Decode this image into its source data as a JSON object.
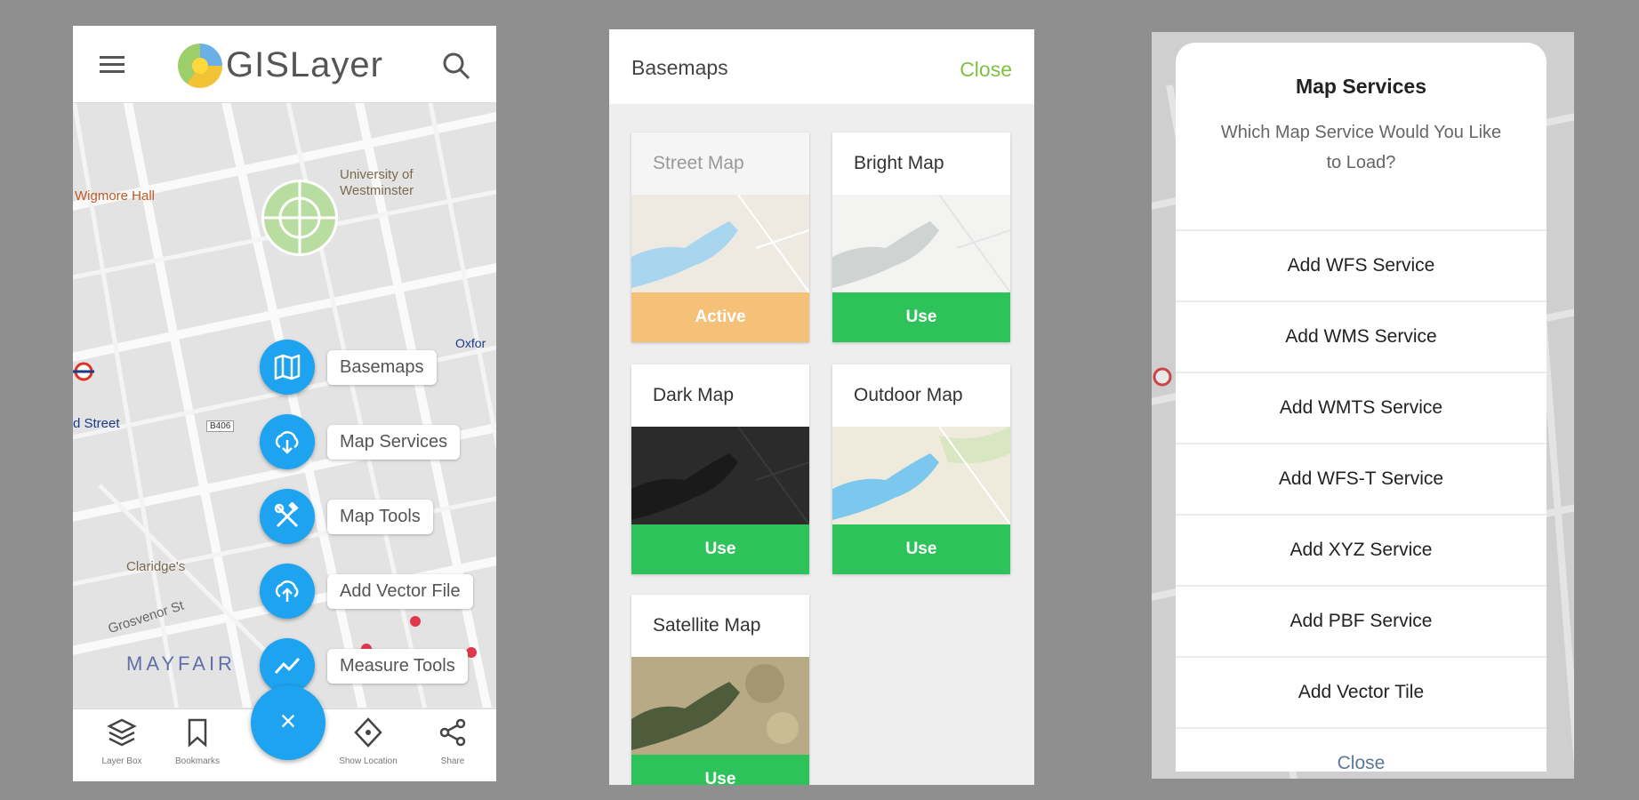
{
  "screen1": {
    "brand": "GISLayer",
    "map_labels": {
      "university": "University of Westminster",
      "wigmore": "Wigmore Hall",
      "street": "d Street",
      "claridges": "Claridge's",
      "grosvenor": "Grosvenor St",
      "mayfair": "MAYFAIR",
      "road_b": "B406",
      "oxford": "Oxfor"
    },
    "menu": [
      {
        "label": "Basemaps",
        "icon": "map-icon"
      },
      {
        "label": "Map Services",
        "icon": "cloud-download-icon"
      },
      {
        "label": "Map Tools",
        "icon": "tools-icon"
      },
      {
        "label": "Add Vector File",
        "icon": "cloud-upload-icon"
      },
      {
        "label": "Measure Tools",
        "icon": "chart-line-icon"
      }
    ],
    "fab_close": "×",
    "bottom_nav": [
      {
        "label": "Layer Box",
        "icon": "layers-icon"
      },
      {
        "label": "Bookmarks",
        "icon": "bookmark-icon"
      },
      {
        "label": "Show Location",
        "icon": "location-icon"
      },
      {
        "label": "Share",
        "icon": "share-icon"
      }
    ]
  },
  "screen2": {
    "title": "Basemaps",
    "close": "Close",
    "cards": [
      {
        "title": "Street Map",
        "button": "Active",
        "active": true
      },
      {
        "title": "Bright Map",
        "button": "Use",
        "active": false
      },
      {
        "title": "Dark Map",
        "button": "Use",
        "active": false
      },
      {
        "title": "Outdoor Map",
        "button": "Use",
        "active": false
      },
      {
        "title": "Satellite Map",
        "button": "Use",
        "active": false
      }
    ],
    "colors": {
      "active": "#f5c078",
      "use": "#2ec25a",
      "close": "#7dc142"
    }
  },
  "screen3": {
    "title": "Map Services",
    "subtitle": "Which Map Service Would You Like to Load?",
    "options": [
      "Add WFS Service",
      "Add WMS Service",
      "Add WMTS Service",
      "Add WFS-T Service",
      "Add XYZ Service",
      "Add PBF Service",
      "Add Vector Tile"
    ],
    "close": "Close"
  }
}
